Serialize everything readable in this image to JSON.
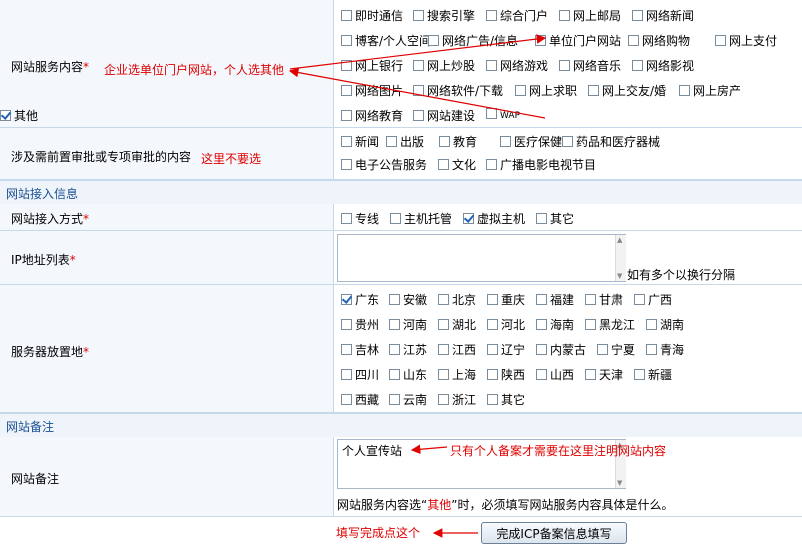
{
  "rows": {
    "service_content": {
      "label": "网站服务内容",
      "required": "*",
      "note": "企业选单位门户网站，个人选其他",
      "options": [
        {
          "label": "即时通信",
          "checked": false
        },
        {
          "label": "搜索引擎",
          "checked": false
        },
        {
          "label": "综合门户",
          "checked": false
        },
        {
          "label": "网上邮局",
          "checked": false
        },
        {
          "label": "网络新闻",
          "checked": false
        },
        {
          "label": "博客/个人空间",
          "checked": false
        },
        {
          "label": "网络广告/信息",
          "checked": false
        },
        {
          "label": "单位门户网站",
          "checked": false
        },
        {
          "label": "网络购物",
          "checked": false
        },
        {
          "label": "网上支付",
          "checked": false
        },
        {
          "label": "网上银行",
          "checked": false
        },
        {
          "label": "网上炒股",
          "checked": false
        },
        {
          "label": "网络游戏",
          "checked": false
        },
        {
          "label": "网络音乐",
          "checked": false
        },
        {
          "label": "网络影视",
          "checked": false
        },
        {
          "label": "网络图片",
          "checked": false
        },
        {
          "label": "网络软件/下载",
          "checked": false
        },
        {
          "label": "网上求职",
          "checked": false
        },
        {
          "label": "网上交友/婚",
          "checked": false
        },
        {
          "label": "网上房产",
          "checked": false
        },
        {
          "label": "网络教育",
          "checked": false
        },
        {
          "label": "网站建设",
          "checked": false
        },
        {
          "label": "WAP",
          "checked": false
        },
        {
          "label": "其他",
          "checked": true
        }
      ]
    },
    "approval": {
      "label": "涉及需前置审批或专项审批的内容",
      "note": "这里不要选",
      "options": [
        {
          "label": "新闻",
          "checked": false
        },
        {
          "label": "出版",
          "checked": false
        },
        {
          "label": "教育",
          "checked": false
        },
        {
          "label": "医疗保健",
          "checked": false
        },
        {
          "label": "药品和医疗器械",
          "checked": false
        },
        {
          "label": "电子公告服务",
          "checked": false
        },
        {
          "label": "文化",
          "checked": false
        },
        {
          "label": "广播电影电视节目",
          "checked": false
        }
      ]
    },
    "access_method": {
      "label": "网站接入方式",
      "required": "*",
      "options": [
        {
          "label": "专线",
          "checked": false
        },
        {
          "label": "主机托管",
          "checked": false
        },
        {
          "label": "虚拟主机",
          "checked": true
        },
        {
          "label": "其它",
          "checked": false
        }
      ]
    },
    "ip_list": {
      "label": "IP地址列表",
      "required": "*",
      "value": "",
      "hint": "如有多个以换行分隔"
    },
    "server_location": {
      "label": "服务器放置地",
      "required": "*",
      "options": [
        {
          "label": "广东",
          "checked": true
        },
        {
          "label": "安徽",
          "checked": false
        },
        {
          "label": "北京",
          "checked": false
        },
        {
          "label": "重庆",
          "checked": false
        },
        {
          "label": "福建",
          "checked": false
        },
        {
          "label": "甘肃",
          "checked": false
        },
        {
          "label": "广西",
          "checked": false
        },
        {
          "label": "贵州",
          "checked": false
        },
        {
          "label": "河南",
          "checked": false
        },
        {
          "label": "湖北",
          "checked": false
        },
        {
          "label": "河北",
          "checked": false
        },
        {
          "label": "海南",
          "checked": false
        },
        {
          "label": "黑龙江",
          "checked": false
        },
        {
          "label": "湖南",
          "checked": false
        },
        {
          "label": "吉林",
          "checked": false
        },
        {
          "label": "江苏",
          "checked": false
        },
        {
          "label": "江西",
          "checked": false
        },
        {
          "label": "辽宁",
          "checked": false
        },
        {
          "label": "内蒙古",
          "checked": false
        },
        {
          "label": "宁夏",
          "checked": false
        },
        {
          "label": "青海",
          "checked": false
        },
        {
          "label": "四川",
          "checked": false
        },
        {
          "label": "山东",
          "checked": false
        },
        {
          "label": "上海",
          "checked": false
        },
        {
          "label": "陕西",
          "checked": false
        },
        {
          "label": "山西",
          "checked": false
        },
        {
          "label": "天津",
          "checked": false
        },
        {
          "label": "新疆",
          "checked": false
        },
        {
          "label": "西藏",
          "checked": false
        },
        {
          "label": "云南",
          "checked": false
        },
        {
          "label": "浙江",
          "checked": false
        },
        {
          "label": "其它",
          "checked": false
        }
      ]
    },
    "remark": {
      "label": "网站备注",
      "value": "个人宣传站",
      "note": "只有个人备案才需要在这里注明网站内容",
      "hint_prefix": "网站服务内容选“",
      "hint_em": "其他",
      "hint_suffix": "”时，必须填写网站服务内容具体是什么。"
    }
  },
  "sections": {
    "access_info": "网站接入信息",
    "remark": "网站备注"
  },
  "footer": {
    "note": "填写完成点这个",
    "submit_label": "完成ICP备案信息填写"
  },
  "colors": {
    "annotation": "#e00000",
    "section_text": "#1a4f93",
    "border": "#c5d9ea"
  }
}
